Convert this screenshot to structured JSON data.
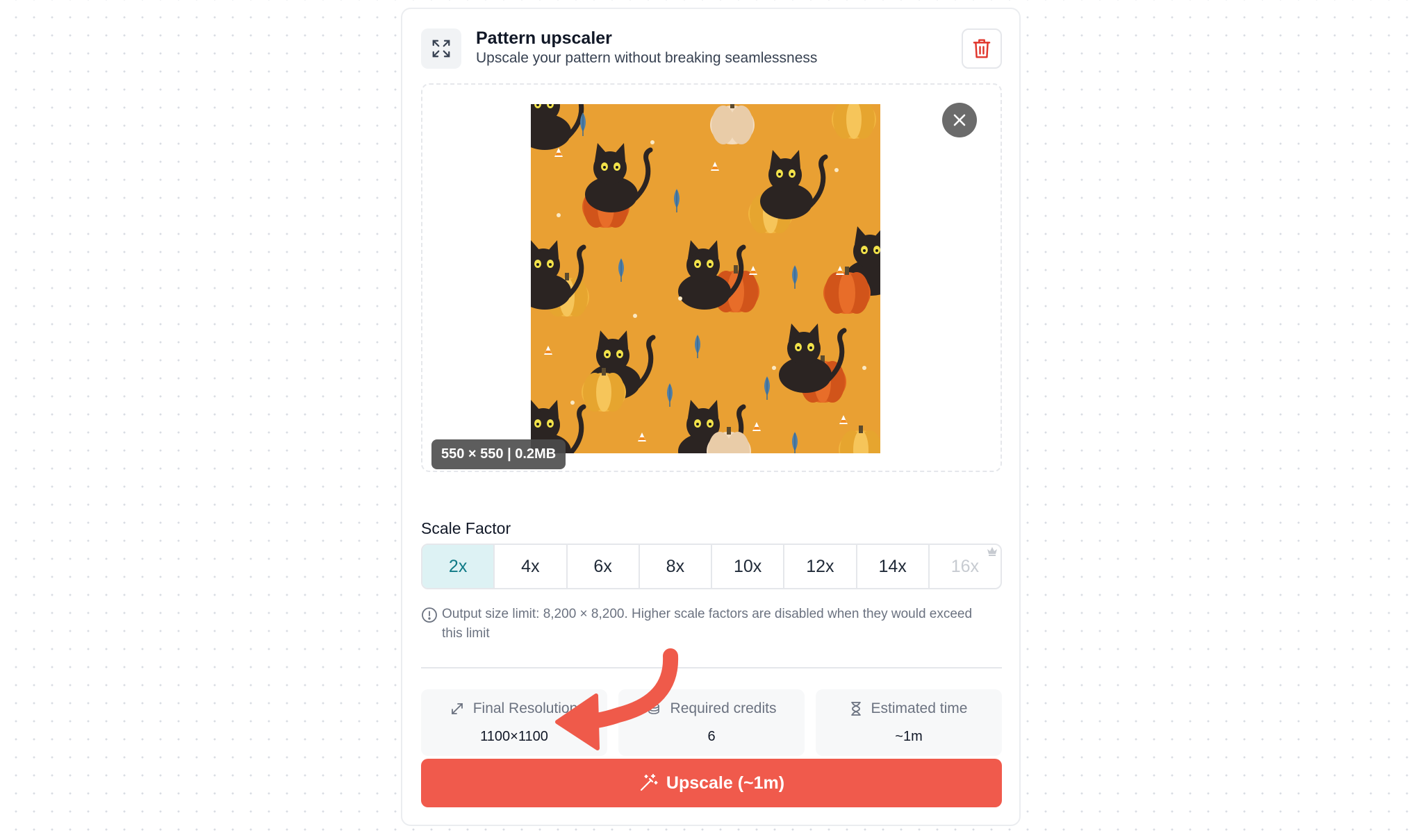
{
  "header": {
    "title": "Pattern upscaler",
    "subtitle": "Upscale your pattern without breaking seamlessness",
    "icon": "expand-icon",
    "delete_icon": "trash-icon"
  },
  "upload": {
    "dimensions_badge": "550 × 550 | 0.2MB",
    "close_icon": "close-icon",
    "pattern_description_colors": {
      "background": "#e9a033",
      "cat": "#2b2422",
      "pumpkin_orange": "#e0611f",
      "pumpkin_yellow": "#f2b640"
    }
  },
  "scale": {
    "label": "Scale Factor",
    "options": [
      {
        "label": "2x",
        "selected": true,
        "disabled": false
      },
      {
        "label": "4x",
        "selected": false,
        "disabled": false
      },
      {
        "label": "6x",
        "selected": false,
        "disabled": false
      },
      {
        "label": "8x",
        "selected": false,
        "disabled": false
      },
      {
        "label": "10x",
        "selected": false,
        "disabled": false
      },
      {
        "label": "12x",
        "selected": false,
        "disabled": false
      },
      {
        "label": "14x",
        "selected": false,
        "disabled": false
      },
      {
        "label": "16x",
        "selected": false,
        "disabled": true
      }
    ],
    "premium_icon": "crown-icon",
    "info": "Output size limit: 8,200 × 8,200. Higher scale factors are disabled when they would exceed this limit"
  },
  "stats": [
    {
      "label": "Final Resolution",
      "value": "1100×1100",
      "icon": "resize-icon"
    },
    {
      "label": "Required credits",
      "value": "6",
      "icon": "coins-icon"
    },
    {
      "label": "Estimated time",
      "value": "~1m",
      "icon": "hourglass-icon"
    }
  ],
  "action": {
    "label": "Upscale (~1m)",
    "icon": "magic-wand-icon"
  },
  "colors": {
    "accent": "#f05a4c",
    "selected_bg": "#ddf2f4",
    "selected_text": "#0f7a86",
    "annotation_arrow": "#f05a4c"
  }
}
